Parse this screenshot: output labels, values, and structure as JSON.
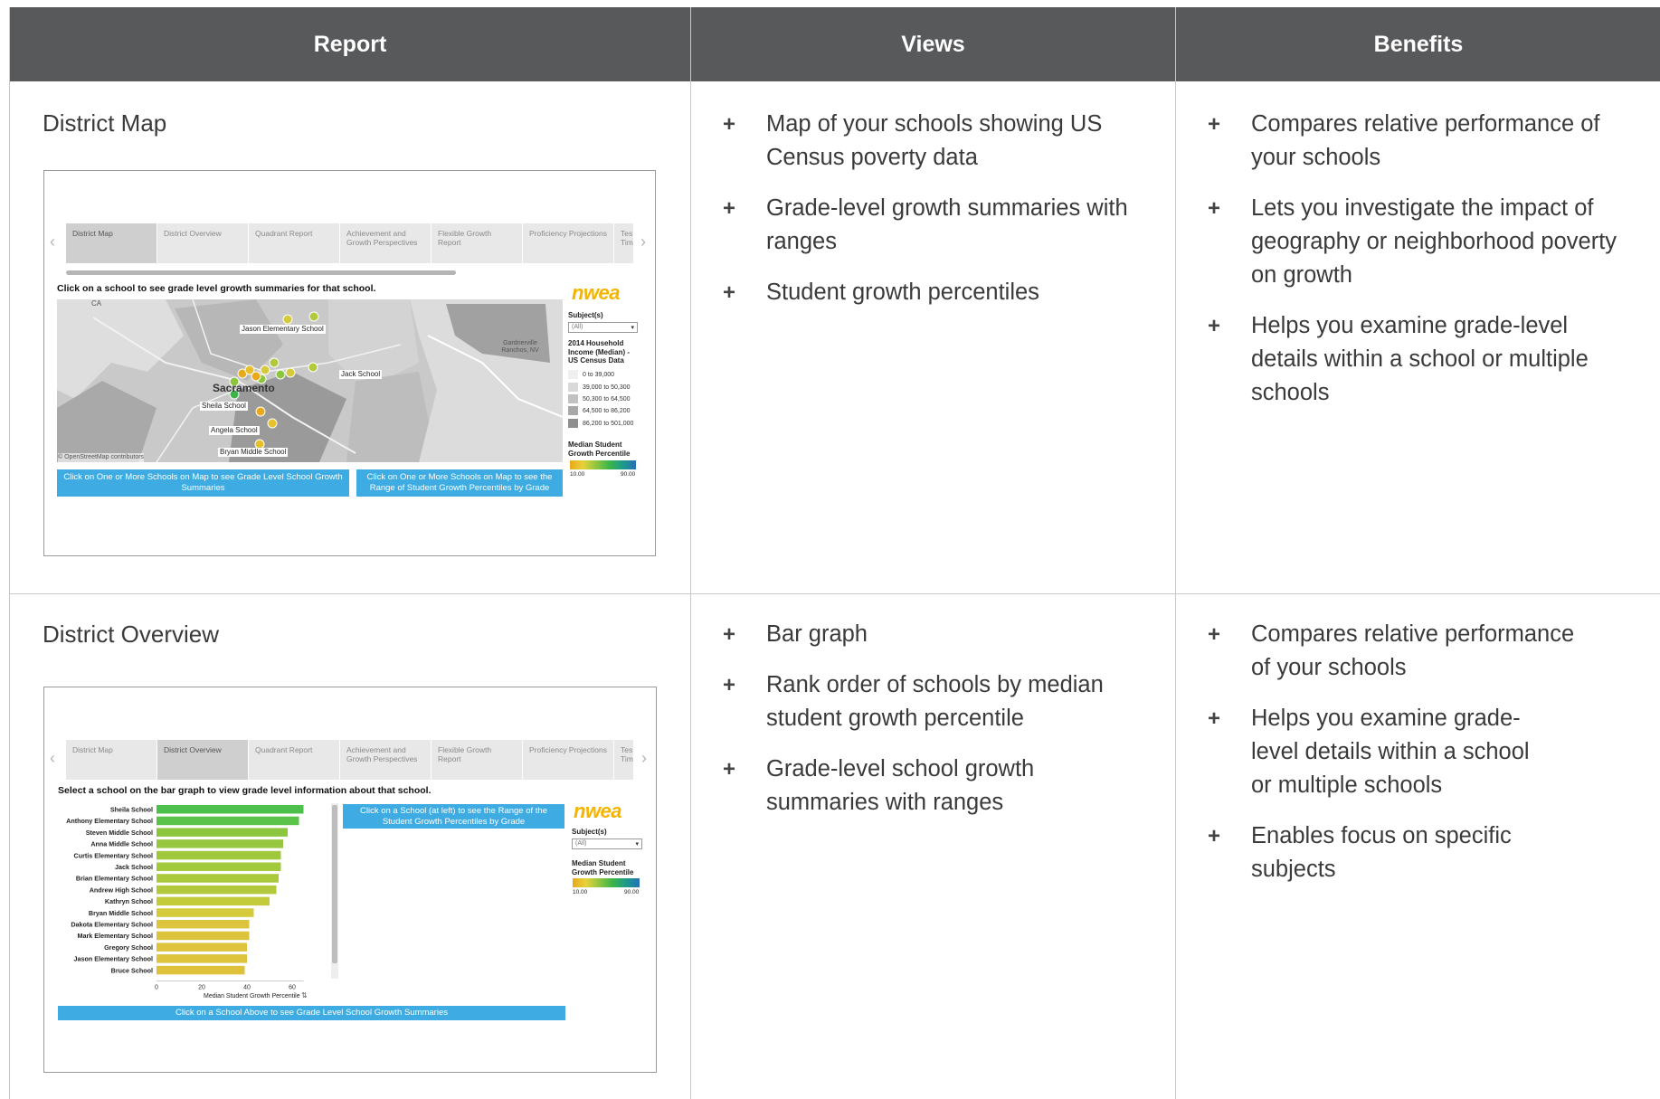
{
  "header": {
    "col_report": "Report",
    "col_views": "Views",
    "col_benefits": "Benefits"
  },
  "rows": [
    {
      "report": "District Map",
      "views": [
        "Map of your schools showing US Census poverty data",
        "Grade-level growth summaries with ranges",
        "Student growth percentiles"
      ],
      "benefits": [
        "Compares relative performance of your schools",
        "Lets you investigate the impact of geography or neighborhood poverty on growth",
        "Helps you examine grade-level details within a school or multiple schools"
      ]
    },
    {
      "report": "District Overview",
      "views": [
        "Bar graph",
        "Rank order of schools by median student growth percentile",
        "Grade-level school growth summaries with ranges"
      ],
      "benefits": [
        "Compares relative performance of your schools",
        "Helps you examine grade-level details within a school or multiple schools",
        "Enables focus on specific subjects"
      ]
    }
  ],
  "bullet_symbol": "+",
  "tabs": [
    "District Map",
    "District Overview",
    "Quadrant Report",
    "Achievement and Growth Perspectives",
    "Flexible Growth Report",
    "Proficiency Projections",
    "Tes Tim"
  ],
  "map_shot": {
    "instruction": "Click on a school to see grade level growth summaries for that school.",
    "logo": "nwea",
    "subjects_label": "Subject(s)",
    "subjects_value": "(All)",
    "income_label": "2014 Household Income (Median) - US Census Data",
    "income_ranges": [
      "0 to 39,000",
      "39,000 to 50,300",
      "50,300 to 64,500",
      "64,500 to 86,200",
      "86,200 to 501,000"
    ],
    "income_colors": [
      "#efefef",
      "#d9d9d9",
      "#c2c2c2",
      "#a8a8a8",
      "#8e8e8e"
    ],
    "growth_label": "Median Student Growth Percentile",
    "growth_min": "10.00",
    "growth_max": "90.00",
    "schools": [
      "Jason Elementary School",
      "Jack School",
      "Sheila School",
      "Angela School",
      "Bryan Middle School"
    ],
    "places": [
      "Sacramento",
      "Gardnerville Ranchos, NV",
      "CA"
    ],
    "attribution": "© OpenStreetMap contributors",
    "button_left": "Click on One or More Schools on Map to see Grade Level School Growth Summaries",
    "button_right": "Click on One or More Schools on Map to see the Range of Student Growth Percentiles by Grade"
  },
  "overview_shot": {
    "instruction": "Select a school on the bar graph to view grade level information about that school.",
    "logo": "nwea",
    "subjects_label": "Subject(s)",
    "subjects_value": "(All)",
    "growth_label": "Median Student Growth Percentile",
    "growth_min": "10.00",
    "growth_max": "90.00",
    "button_top": "Click on a School (at left) to see the Range of the Student Growth Percentiles by Grade",
    "button_bottom": "Click on a School Above to see Grade Level School Growth Summaries",
    "x_axis_label": "Median Student Growth Percentile",
    "x_ticks": [
      "0",
      "20",
      "40",
      "60"
    ]
  },
  "chart_data": {
    "type": "bar",
    "orientation": "horizontal",
    "categories": [
      "Sheila School",
      "Anthony Elementary School",
      "Steven Middle School",
      "Anna Middle School",
      "Curtis Elementary School",
      "Jack School",
      "Brian Elementary School",
      "Andrew High School",
      "Kathryn School",
      "Bryan Middle School",
      "Dakota Elementary School",
      "Mark Elementary School",
      "Gregory School",
      "Jason Elementary School",
      "Bruce School"
    ],
    "values": [
      65,
      63,
      58,
      56,
      55,
      55,
      54,
      53,
      50,
      43,
      41,
      41,
      40,
      40,
      39
    ],
    "colors": [
      "#4cc04a",
      "#5bc24a",
      "#8cc63f",
      "#97c73e",
      "#9fc83d",
      "#a3c93c",
      "#aac93b",
      "#b2c93b",
      "#c3cb3a",
      "#d5c93c",
      "#dcc43c",
      "#dcc33c",
      "#dec33c",
      "#dec33c",
      "#dfc23c"
    ],
    "xlabel": "Median Student Growth Percentile",
    "xlim": [
      0,
      70
    ]
  }
}
